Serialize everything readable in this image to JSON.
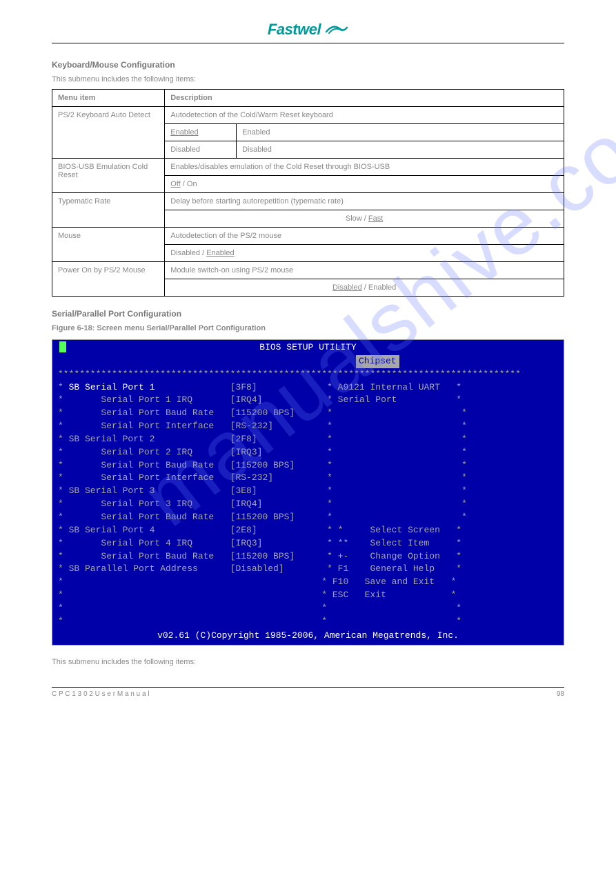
{
  "header": {
    "brand": "Fastwel",
    "doc_code": "CPC1302"
  },
  "intro": {
    "title": "Keyboard/Mouse Configuration",
    "desc": "This submenu includes the following items:"
  },
  "table": {
    "header_left": "Menu item",
    "header_right": "Description",
    "rows": [
      {
        "left": "PS/2 Keyboard Auto Detect",
        "r1": "Autodetection of the Cold/Warm Reset keyboard",
        "r2a": "Enabled",
        "r2b": "Enabled",
        "r3a": "Disabled",
        "r3b": "Disabled"
      },
      {
        "left": "BIOS-USB Emulation Cold Reset",
        "r1": "Enables/disables emulation of the Cold Reset through BIOS-USB",
        "r2": "Off / On"
      },
      {
        "left": "Typematic Rate",
        "r1": "Delay before starting autorepetition (typematic rate)",
        "r2": "Slow / Fast"
      },
      {
        "left": "Mouse",
        "r1": "Autodetection of the PS/2 mouse",
        "r2": "Disabled / Enabled"
      },
      {
        "left": "Power On by PS/2 Mouse",
        "r1": "Module switch-on using PS/2 mouse",
        "r2": "Disabled / Enabled"
      }
    ]
  },
  "serial_section": {
    "title": "Serial/Parallel Port Configuration",
    "fig": "Figure 6-18:   Screen menu Serial/Parallel Port Configuration"
  },
  "bios": {
    "title": "BIOS SETUP UTILITY",
    "tab": "Chipset",
    "help1": "A9121 Internal UART",
    "help2": "Serial Port",
    "items": [
      {
        "label": "SB Serial Port 1",
        "value": "[3F8]",
        "hl": true
      },
      {
        "label": "      Serial Port 1 IRQ",
        "value": "[IRQ4]"
      },
      {
        "label": "      Serial Port Baud Rate",
        "value": "[115200 BPS]"
      },
      {
        "label": "      Serial Port Interface",
        "value": "[RS-232]"
      },
      {
        "label": "SB Serial Port 2",
        "value": "[2F8]"
      },
      {
        "label": "      Serial Port 2 IRQ",
        "value": "[IRQ3]"
      },
      {
        "label": "      Serial Port Baud Rate",
        "value": "[115200 BPS]"
      },
      {
        "label": "      Serial Port Interface",
        "value": "[RS-232]"
      },
      {
        "label": "SB Serial Port 3",
        "value": "[3E8]"
      },
      {
        "label": "      Serial Port 3 IRQ",
        "value": "[IRQ4]"
      },
      {
        "label": "      Serial Port Baud Rate",
        "value": "[115200 BPS]"
      },
      {
        "label": "SB Serial Port 4",
        "value": "[2E8]"
      },
      {
        "label": "      Serial Port 4 IRQ",
        "value": "[IRQ3]"
      },
      {
        "label": "      Serial Port Baud Rate",
        "value": "[115200 BPS]"
      },
      {
        "label": "SB Parallel Port Address",
        "value": "[Disabled]"
      }
    ],
    "keys": [
      {
        "k": "*",
        "d": "Select Screen"
      },
      {
        "k": "**",
        "d": "Select Item"
      },
      {
        "k": "+-",
        "d": "Change Option"
      },
      {
        "k": "F1",
        "d": "General Help"
      },
      {
        "k": "F10",
        "d": "Save and Exit"
      },
      {
        "k": "ESC",
        "d": "Exit"
      }
    ],
    "footer": "v02.61 (C)Copyright 1985-2006, American Megatrends, Inc."
  },
  "post": "This submenu includes the following items:",
  "footer": {
    "left": "C P C 1 3 0 2   U s e r   M a n u a l",
    "right": "98"
  },
  "watermark": "manualshive.com"
}
